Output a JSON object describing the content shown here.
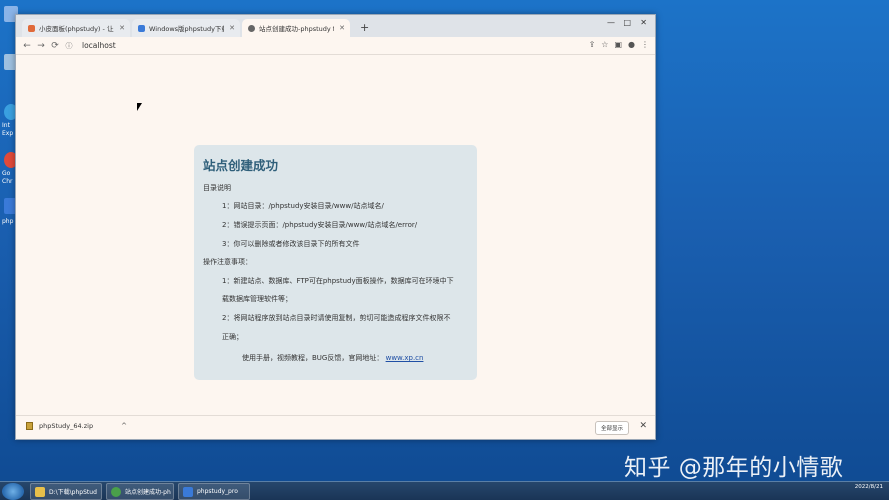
{
  "desktop": {
    "labels": [
      "Int",
      "Exp",
      "Go",
      "Chr",
      "php"
    ]
  },
  "browser": {
    "tabs": [
      {
        "label": "小皮面板(phpstudy) - 让天下没",
        "active": false,
        "color": "#e06a3a"
      },
      {
        "label": "Windows版phpstudy下载 - 小",
        "active": false,
        "color": "#3a7ad8"
      },
      {
        "label": "站点创建成功-phpstudy for wi",
        "active": true,
        "color": "#555555"
      }
    ],
    "new_tab_glyph": "+",
    "url": "localhost",
    "nav": {
      "back": "←",
      "forward": "→",
      "reload": "⟳"
    },
    "window_controls": {
      "minimize": "—",
      "maximize": "□",
      "close": "✕"
    }
  },
  "page": {
    "title": "站点创建成功",
    "dir_heading": "目录说明",
    "dir_items": [
      "1：网站目录：/phpstudy安装目录/www/站点域名/",
      "2：错误提示页面：/phpstudy安装目录/www/站点域名/error/",
      "3：你可以删除或者修改该目录下的所有文件"
    ],
    "notes_heading": "操作注意事项：",
    "notes": [
      [
        "1：新建站点、数据库、FTP可在phpstudy面板操作，数据库可在环境中下",
        "载数据库管理软件等；"
      ],
      [
        "2：将网站程序放到站点目录时请使用复制，剪切可能造成程序文件权限不",
        "正确；"
      ]
    ],
    "footer_text": "使用手册，视频教程，BUG反馈，官网地址：",
    "footer_link": "www.xp.cn"
  },
  "downloads": {
    "file": "phpStudy_64.zip",
    "show_all": "全部显示"
  },
  "watermark": "知乎 @那年的小情歌",
  "taskbar": {
    "items": [
      {
        "label": "D:\\下载\\phpStud",
        "color": "#e8c04a"
      },
      {
        "label": "站点创建成功-ph",
        "color": "#4aa04a"
      },
      {
        "label": "phpstudy_pro",
        "color": "#3a7ad8"
      }
    ],
    "clock": "2022/8/21"
  }
}
